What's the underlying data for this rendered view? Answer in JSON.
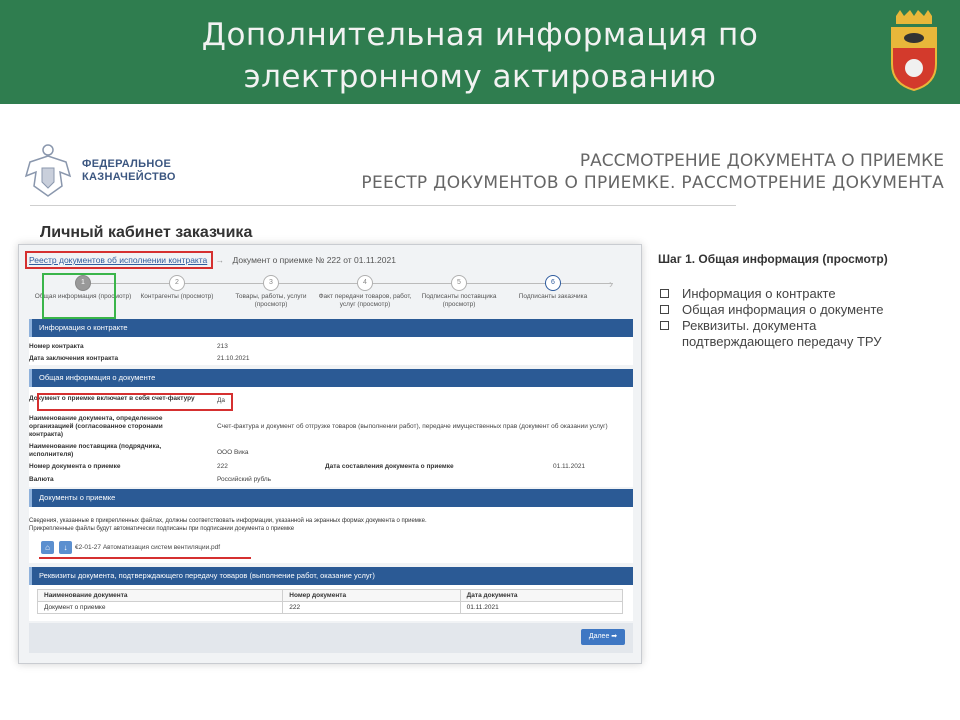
{
  "slide": {
    "title_line1": "Дополнительная информация по",
    "title_line2": "электронному актированию"
  },
  "org": {
    "name_line1": "ФЕДЕРАЛЬНОЕ",
    "name_line2": "КАЗНАЧЕЙСТВО"
  },
  "heading": {
    "line1": "РАССМОТРЕНИЕ ДОКУМЕНТА О ПРИЕМКЕ",
    "line2": "РЕЕСТР ДОКУМЕНТОВ О ПРИЕМКЕ. РАССМОТРЕНИЕ ДОКУМЕНТА"
  },
  "cabinet_title": "Личный кабинет заказчика",
  "breadcrumbs": {
    "link": "Реестр документов об исполнении контракта",
    "arrow": "→",
    "current": "Документ о приемке № 222 от 01.11.2021"
  },
  "steps": [
    {
      "num": "1",
      "label": "Общая информация (просмотр)"
    },
    {
      "num": "2",
      "label": "Контрагенты (просмотр)"
    },
    {
      "num": "3",
      "label": "Товары, работы, услуги (просмотр)"
    },
    {
      "num": "4",
      "label": "Факт передачи товаров, работ, услуг (просмотр)"
    },
    {
      "num": "5",
      "label": "Подписанты поставщика (просмотр)"
    },
    {
      "num": "6",
      "label": "Подписанты заказчика"
    }
  ],
  "sections": {
    "contract": {
      "header": "Информация о контракте",
      "number_label": "Номер контракта",
      "number_value": "213",
      "date_label": "Дата заключения контракта",
      "date_value": "21.10.2021"
    },
    "general": {
      "header": "Общая информация о документе",
      "invoice_label": "Документ о приемке включает в себя счет-фактуру",
      "invoice_value": "Да",
      "name_label": "Наименование документа, определенное организацией (согласованное сторонами контракта)",
      "name_value": "Счет-фактура и документ об отгрузке товаров (выполнении работ), передаче имущественных прав (документ об оказании услуг)",
      "supplier_label": "Наименование поставщика (подрядчика, исполнителя)",
      "supplier_value": "ООО Вика",
      "docnum_label": "Номер документа о приемке",
      "docnum_value": "222",
      "docdate_label": "Дата составления документа о приемке",
      "docdate_value": "01.11.2021",
      "currency_label": "Валюта",
      "currency_value": "Российский рубль"
    },
    "docs": {
      "header": "Документы о приемке",
      "note_line1": "Сведения, указанные в прикрепленных файлах, должны соответствовать информации, указанной на экранных формах документа о приемке.",
      "note_line2": "Прикрепленные файлы будут автоматически подписаны при подписании документа о приемке",
      "file_name": "€2-01-27 Автоматизация систем вентиляции.pdf"
    },
    "requisites": {
      "header": "Реквизиты документа, подтверждающего передачу товаров (выполнение работ, оказание услуг)",
      "columns": [
        "Наименование документа",
        "Номер документа",
        "Дата документа"
      ],
      "rows": [
        [
          "Документ о приемке",
          "222",
          "01.11.2021"
        ]
      ]
    }
  },
  "next_button": "Далее",
  "right_panel": {
    "step_title": "Шаг 1. Общая информация (просмотр)",
    "items": [
      "Информация о контракте",
      "Общая информация о документе",
      "Реквизиты. документа подтверждающего передачу ТРУ"
    ]
  },
  "colors": {
    "header_green": "#2f7d4f",
    "section_blue": "#2b5a95",
    "highlight_red": "#d53030",
    "highlight_green": "#3ab54a"
  },
  "icons": [
    "coat-of-arms-icon",
    "eagle-emblem-icon",
    "home-icon",
    "download-icon",
    "arrow-right-icon"
  ]
}
